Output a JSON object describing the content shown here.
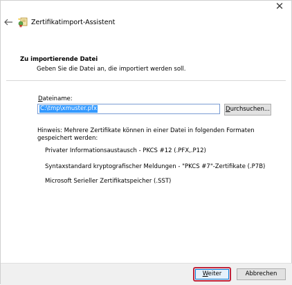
{
  "window": {
    "close_glyph": "✕",
    "title": "Zertifikatimport-Assistent"
  },
  "icons": {
    "back": "arrow-left-icon",
    "wizard": "certificate-wizard-icon",
    "close": "close-icon"
  },
  "header": {
    "title": "Zu importierende Datei",
    "subtitle": "Geben Sie die Datei an, die importiert werden soll."
  },
  "form": {
    "filename_label_prefix": "D",
    "filename_label_rest": "ateiname:",
    "filename_value": "C:\\tmp\\xmuster.pfx",
    "browse_label_prefix": "D",
    "browse_label_rest": "urchsuchen..."
  },
  "hint": {
    "text": "Hinweis: Mehrere Zertifikate können in einer Datei in folgenden Formaten gespeichert werden:",
    "formats": [
      "Privater Informationsaustausch - PKCS #12 (.PFX,.P12)",
      "Syntaxstandard kryptografischer Meldungen - \"PKCS #7\"-Zertifikate (.P7B)",
      "Microsoft Serieller Zertifikatspeicher (.SST)"
    ]
  },
  "footer": {
    "next_label_prefix": "W",
    "next_label_rest": "eiter",
    "cancel_label": "Abbrechen"
  },
  "colors": {
    "selection": "#3399ff",
    "highlight": "#c0223a",
    "focus_border": "#0078d7"
  }
}
